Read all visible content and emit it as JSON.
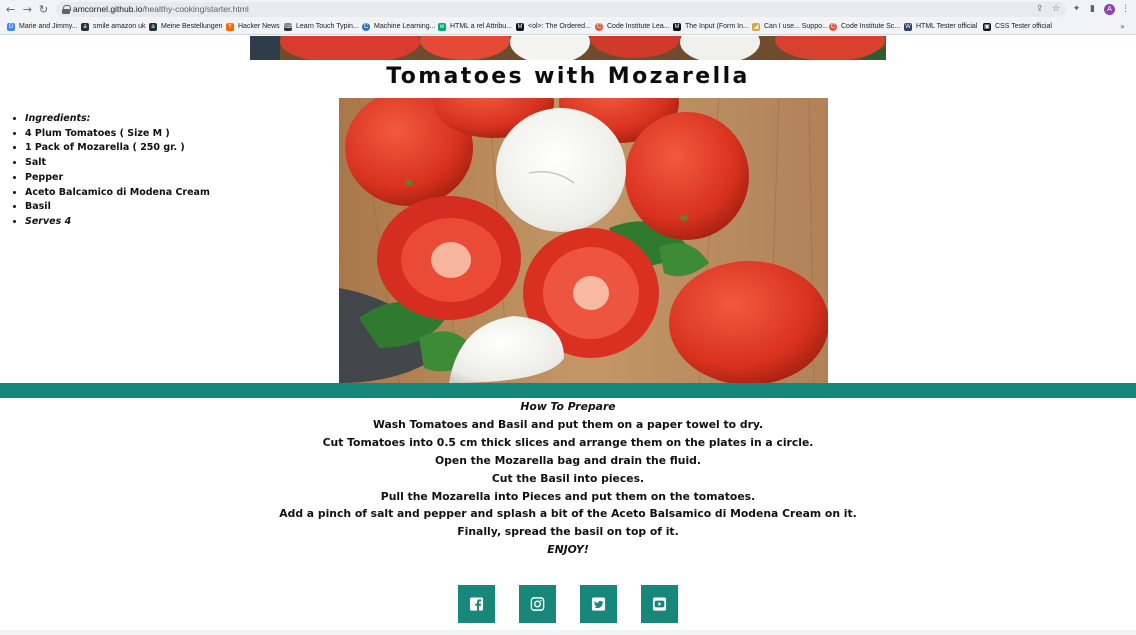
{
  "browser": {
    "url_host": "amcornel.github.io",
    "url_path": "/healthy-cooking/starter.html",
    "profile_initial": "A",
    "bookmarks": [
      {
        "label": "Marie and Jimmy...",
        "icon": "google-icon"
      },
      {
        "label": "smile amazon uk",
        "icon": "amazon-icon"
      },
      {
        "label": "Meine Bestellungen",
        "icon": "amazon-icon"
      },
      {
        "label": "Hacker News",
        "icon": "hacker-news-icon"
      },
      {
        "label": "Learn Touch Typin...",
        "icon": "typing-icon"
      },
      {
        "label": "Machine Learning...",
        "icon": "coursera-icon"
      },
      {
        "label": "HTML a rel Attribu...",
        "icon": "w3schools-icon"
      },
      {
        "label": "<ol>: The Ordered...",
        "icon": "mdn-icon"
      },
      {
        "label": "Code Institute Lea...",
        "icon": "code-institute-icon"
      },
      {
        "label": "The Input (Form In...",
        "icon": "mdn-icon"
      },
      {
        "label": "Can I use... Suppo...",
        "icon": "caniuse-icon"
      },
      {
        "label": "Code Institute Sc...",
        "icon": "code-institute-icon"
      },
      {
        "label": "HTML Tester official",
        "icon": "validator-icon"
      },
      {
        "label": "CSS Tester official",
        "icon": "validator-icon"
      }
    ]
  },
  "page": {
    "title": "Tomatoes with Mozarella",
    "ingredients": [
      "Ingredients:",
      "4 Plum Tomatoes ( Size M )",
      "1 Pack of Mozarella ( 250 gr. )",
      "Salt",
      "Pepper",
      "Aceto Balcamico di Modena Cream",
      "Basil",
      "Serves 4"
    ],
    "prepare": [
      "How To Prepare",
      "Wash Tomatoes and Basil and put them on a paper towel to dry.",
      "Cut Tomatoes into 0.5 cm thick slices and arrange them on the plates in a circle.",
      "Open the Mozarella bag and drain the fluid.",
      "Cut the Basil into pieces.",
      "Pull the Mozarella into Pieces and put them on the tomatoes.",
      "Add a pinch of salt and pepper and splash a bit of the Aceto Balsamico di Modena Cream on it.",
      "Finally, spread the basil on top of it.",
      "ENJOY!"
    ],
    "social": [
      {
        "name": "facebook",
        "icon": "facebook-icon"
      },
      {
        "name": "instagram",
        "icon": "instagram-icon"
      },
      {
        "name": "twitter",
        "icon": "twitter-icon"
      },
      {
        "name": "youtube",
        "icon": "youtube-icon"
      }
    ]
  },
  "colors": {
    "accent": "#17877a",
    "text": "#111111",
    "chrome": "#f1f3f4"
  }
}
